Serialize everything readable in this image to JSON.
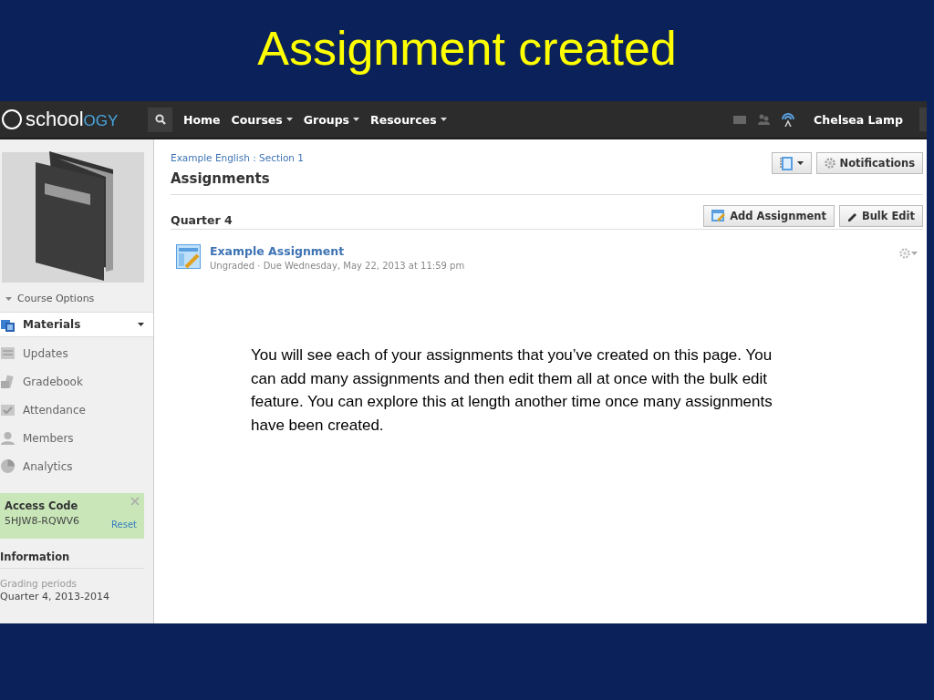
{
  "slide": {
    "title": "Assignment created"
  },
  "topbar": {
    "logo": {
      "text": "school",
      "accent": "OGY"
    },
    "nav": [
      {
        "label": "Home",
        "menu": false
      },
      {
        "label": "Courses",
        "menu": true
      },
      {
        "label": "Groups",
        "menu": true
      },
      {
        "label": "Resources",
        "menu": true
      }
    ],
    "user": "Chelsea Lamp"
  },
  "sidebar": {
    "course_options": "Course Options",
    "items": [
      {
        "label": "Materials",
        "selected": true
      },
      {
        "label": "Updates",
        "selected": false
      },
      {
        "label": "Gradebook",
        "selected": false
      },
      {
        "label": "Attendance",
        "selected": false
      },
      {
        "label": "Members",
        "selected": false
      },
      {
        "label": "Analytics",
        "selected": false
      }
    ],
    "access_code": {
      "label": "Access Code",
      "code": "5HJW8-RQWV6",
      "reset": "Reset"
    },
    "information": {
      "heading": "Information",
      "label": "Grading periods",
      "value": "Quarter 4, 2013-2014"
    }
  },
  "main": {
    "breadcrumb": "Example English : Section 1",
    "heading": "Assignments",
    "notifications": "Notifications",
    "section": "Quarter 4",
    "add_button": "Add Assignment",
    "bulk_button": "Bulk Edit",
    "assignments": [
      {
        "title": "Example Assignment",
        "meta": "Ungraded · Due Wednesday, May 22, 2013 at 11:59 pm"
      }
    ]
  },
  "caption": "You will see each of your assignments that you’ve created on this page.  You can add many assignments and then edit them all at once with the bulk edit feature.  You can explore this at length another time once many assignments have been created."
}
